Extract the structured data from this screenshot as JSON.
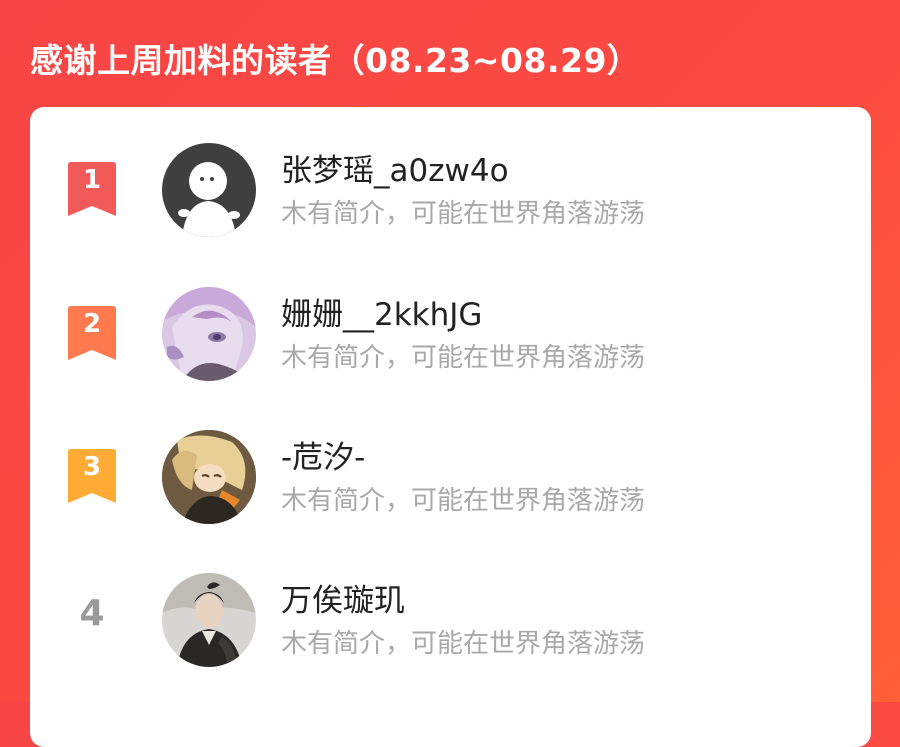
{
  "header": {
    "title": "感谢上周加料的读者（08.23~08.29）"
  },
  "readers": [
    {
      "rank": "1",
      "name": "张梦瑶_a0zw4o",
      "bio": "木有简介，可能在世界角落游荡",
      "avatar": "default-avatar-icon",
      "badge_color": "#f25a5a"
    },
    {
      "rank": "2",
      "name": "姗姗__2kkhJG",
      "bio": "木有简介，可能在世界角落游荡",
      "avatar": "anime-girl-avatar",
      "badge_color": "#ff7b4f"
    },
    {
      "rank": "3",
      "name": "-苊汐-",
      "bio": "木有简介，可能在世界角落游荡",
      "avatar": "anime-character-avatar",
      "badge_color": "#ffab36"
    },
    {
      "rank": "4",
      "name": "万俟璇玑",
      "bio": "木有简介，可能在世界角落游荡",
      "avatar": "costume-portrait-avatar",
      "badge_color": null
    }
  ],
  "colors": {
    "background": "#f84545",
    "card": "#ffffff",
    "name_text": "#222222",
    "bio_text": "#a9a9a9",
    "plain_rank": "#9a9a9a"
  }
}
